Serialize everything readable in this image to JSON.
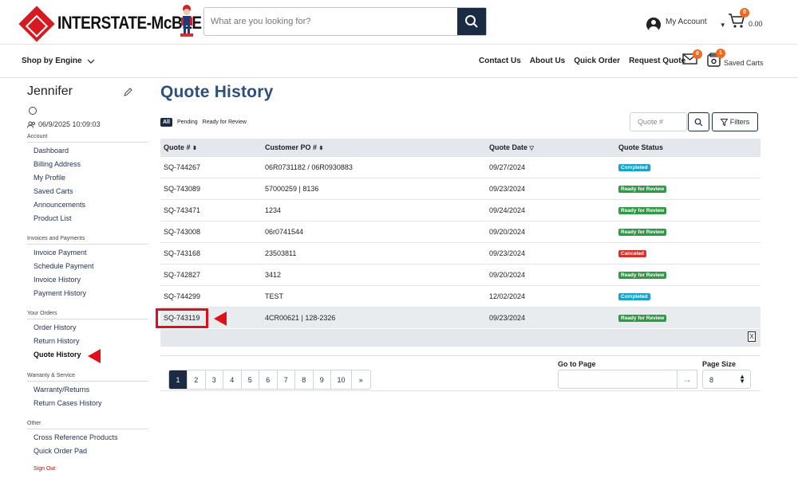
{
  "header": {
    "logo_text": "INTERSTATE-McBEE",
    "search_placeholder": "What are you looking for?",
    "account_label": "My Account",
    "cart_count": "0",
    "cart_total": "0.00"
  },
  "nav": {
    "shop_label": "Shop by Engine",
    "links": [
      "Contact Us",
      "About Us",
      "Quick Order",
      "Request Quote"
    ],
    "mail_count": "0",
    "saved_count": "1",
    "saved_label": "Saved Carts"
  },
  "sidebar": {
    "user_name": "Jennifer",
    "last_login": "06/9/2025 10:09:03",
    "sections": [
      {
        "title": "Account",
        "items": [
          "Dashboard",
          "Billing Address",
          "My Profile",
          "Saved Carts",
          "Announcements",
          "Product List"
        ]
      },
      {
        "title": "Invoices and Payments",
        "items": [
          "Invoice Payment",
          "Schedule Payment",
          "Invoice History",
          "Payment History"
        ]
      },
      {
        "title": "Your Orders",
        "items": [
          "Order History",
          "Return History",
          "Quote History"
        ]
      },
      {
        "title": "Warranty & Service",
        "items": [
          "Warranty/Returns",
          "Return Cases History"
        ]
      },
      {
        "title": "Other",
        "items": [
          "Cross Reference Products",
          "Quick Order Pad"
        ]
      }
    ],
    "sign_out": "Sign Out"
  },
  "main": {
    "title": "Quote History",
    "filter_tabs": [
      "All",
      "Pending",
      "Ready for Review"
    ],
    "quote_search_placeholder": "Quote #",
    "filters_label": "Filters",
    "columns": [
      "Quote #",
      "Customer PO #",
      "Quote Date",
      "Quote Status"
    ],
    "rows": [
      {
        "quote": "SQ-744267",
        "po": "06R0731182 / 06R0930883",
        "date": "09/27/2024",
        "status": "Completed"
      },
      {
        "quote": "SQ-743089",
        "po": "57000259 | 8136",
        "date": "09/23/2024",
        "status": "Ready for Review"
      },
      {
        "quote": "SQ-743471",
        "po": "1234",
        "date": "09/24/2024",
        "status": "Ready for Review"
      },
      {
        "quote": "SQ-743008",
        "po": "06r0741544",
        "date": "09/20/2024",
        "status": "Ready for Review"
      },
      {
        "quote": "SQ-743168",
        "po": "23503811",
        "date": "09/23/2024",
        "status": "Canceled"
      },
      {
        "quote": "SQ-742827",
        "po": "3412",
        "date": "09/20/2024",
        "status": "Ready for Review"
      },
      {
        "quote": "SQ-744299",
        "po": "TEST",
        "date": "12/02/2024",
        "status": "Completed"
      },
      {
        "quote": "SQ-743119",
        "po": "4CR00621 | 128-2326",
        "date": "09/23/2024",
        "status": "Ready for Review"
      }
    ],
    "status_colors": {
      "Completed": "#1aa3c9",
      "Ready for Review": "#2e9a45",
      "Canceled": "#d9302b"
    },
    "pages": [
      "1",
      "2",
      "3",
      "4",
      "5",
      "6",
      "7",
      "8",
      "9",
      "10",
      "»"
    ],
    "goto_label": "Go to Page",
    "page_size_label": "Page Size",
    "page_size_value": "8"
  }
}
